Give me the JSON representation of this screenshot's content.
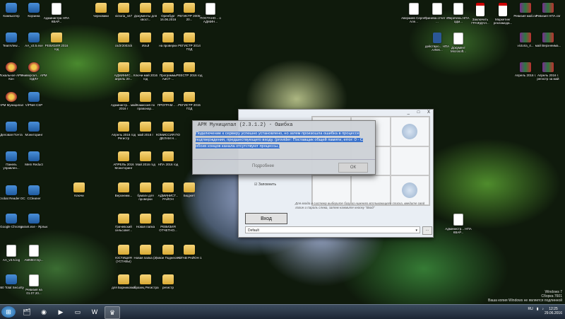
{
  "desktop": {
    "icons": [
      {
        "label": "Компьютер",
        "kind": "app"
      },
      {
        "label": "Корзина",
        "kind": "app"
      },
      {
        "label": "Администра НПА КВАР...",
        "kind": "doc"
      },
      {
        "label": "черновики",
        "kind": "folder"
      },
      {
        "label": "victoria_447",
        "kind": "folder"
      },
      {
        "label": "Документы для хвост...",
        "kind": "folder"
      },
      {
        "label": "Оренбург 16.06.2016",
        "kind": "folder"
      },
      {
        "label": "РЕГИСТР 2005-20...",
        "kind": "folder"
      },
      {
        "label": "ПОСТАНО... о АДМИН...",
        "kind": "doc"
      },
      {
        "label": "Аверкиев Сергей Але...",
        "kind": "doc"
      },
      {
        "label": "Гринева отчет по ...",
        "kind": "doc"
      },
      {
        "label": "Перечень НПА адм...",
        "kind": "doc"
      },
      {
        "label": "Заключить ГРАЖДАН...",
        "kind": "pdf"
      },
      {
        "label": "Маркетинг рекламода...",
        "kind": "pdf"
      },
      {
        "label": "Ревизия май.rar",
        "kind": "rar"
      },
      {
        "label": "Ревизия НПА.rar",
        "kind": "rar"
      },
      {
        "label": "TeamView...",
        "kind": "app"
      },
      {
        "label": "AA_v3.5.exe",
        "kind": "app"
      },
      {
        "label": "РЕВИЗИЯ 2016 год",
        "kind": "folder"
      },
      {
        "label": "сsdrr2003ck",
        "kind": "folder"
      },
      {
        "label": "Изъй",
        "kind": "folder"
      },
      {
        "label": "на проверки",
        "kind": "folder"
      },
      {
        "label": "РЕГИСТР 2014 ГОД",
        "kind": "folder"
      },
      {
        "label": "действую... НПА АЛЕК...",
        "kind": "word"
      },
      {
        "label": "Документ Microsoft...",
        "kind": "doc"
      },
      {
        "label": "victoria_4...",
        "kind": "rar"
      },
      {
        "label": "май Верхнеима...",
        "kind": "rar"
      },
      {
        "label": "Локальное АРМ Кон",
        "kind": "crest"
      },
      {
        "label": "Универсал... АРМ ОДЛУ",
        "kind": "crest"
      },
      {
        "label": "АДМИНИС... апрель 20...",
        "kind": "folder"
      },
      {
        "label": "Ключи май 2016 год",
        "kind": "folder"
      },
      {
        "label": "Программы АиСТ-...",
        "kind": "folder"
      },
      {
        "label": "РЕЕСТР 2016 год",
        "kind": "folder"
      },
      {
        "label": "Апрель 2016 г.",
        "kind": "rar"
      },
      {
        "label": "Апрель 2016 г. регистр за май 2016...",
        "kind": "rar"
      },
      {
        "label": "АРМ Муниципал",
        "kind": "crest"
      },
      {
        "label": "ViPNet CSP",
        "kind": "app"
      },
      {
        "label": "Администр... май 2016 г",
        "kind": "folder"
      },
      {
        "label": "Комиссия по правонар...",
        "kind": "folder"
      },
      {
        "label": "ПРОГРАМ... ...",
        "kind": "folder"
      },
      {
        "label": "РЕГИСТР 2015 ГОД",
        "kind": "folder"
      },
      {
        "label": "Деловая Почта",
        "kind": "app"
      },
      {
        "label": "Мониторинг",
        "kind": "app"
      },
      {
        "label": "Апрель 2016 год Регистр",
        "kind": "folder"
      },
      {
        "label": "май 2016 г",
        "kind": "folder"
      },
      {
        "label": "КОМИССИЯ ПО ДЕЛАМ Н...",
        "kind": "folder"
      },
      {
        "label": "Панель управлен...",
        "kind": "app"
      },
      {
        "label": "Mem Reduct",
        "kind": "app"
      },
      {
        "label": "АПРЕЛЬ 2016 Мониторинг",
        "kind": "folder"
      },
      {
        "label": "Май 2016 год",
        "kind": "folder"
      },
      {
        "label": "НПА 2016 год",
        "kind": "folder"
      },
      {
        "label": "Ключи",
        "kind": "folder"
      },
      {
        "label": "Верхнеим...",
        "kind": "folder"
      },
      {
        "label": "Acrobat Reader DC",
        "kind": "app"
      },
      {
        "label": "CCleaner",
        "kind": "app"
      },
      {
        "label": "бумаги для проверки",
        "kind": "folder"
      },
      {
        "label": "АДМИНИСТ... РАЙОН",
        "kind": "folder"
      },
      {
        "label": "Бюджет",
        "kind": "folder"
      },
      {
        "label": "Google Chrome",
        "kind": "app"
      },
      {
        "label": "garant.exe - Ярлык",
        "kind": "app"
      },
      {
        "label": "Грачевский сельсовет...",
        "kind": "folder"
      },
      {
        "label": "Новая папка",
        "kind": "folder"
      },
      {
        "label": "РЕВИЗИЯ ОТЧЕТНО...",
        "kind": "folder"
      },
      {
        "label": "Администр... НПА КВАР...",
        "kind": "doc"
      },
      {
        "label": "AA_v3.5.log",
        "kind": "doc"
      },
      {
        "label": "АММЕУ.mp...",
        "kind": "doc"
      },
      {
        "label": "ЮСТИЦИЯ (УСТАВЫ)",
        "kind": "folder"
      },
      {
        "label": "Новая папка (2)",
        "kind": "folder"
      },
      {
        "label": "Новое Поднесени",
        "kind": "folder"
      },
      {
        "label": "УСТАВ РАЙОН 1",
        "kind": "folder"
      },
      {
        "label": "360 Total Security",
        "kind": "app"
      },
      {
        "label": "Ревизия на 01.07.20...",
        "kind": "doc"
      },
      {
        "label": "для Барниковой",
        "kind": "folder"
      },
      {
        "label": "образец Регистра",
        "kind": "folder"
      },
      {
        "label": "регистр",
        "kind": "folder"
      }
    ],
    "colors": {
      "selection": "#3b73cc",
      "taskbar": "#1c2634"
    }
  },
  "app_window": {
    "controls": [
      "_",
      "□",
      "X"
    ],
    "remember_label": "Запомнить",
    "hint": "Для входа в систему выберите базу из нижнего всплывающего списка, введите свой логин и пароль слева, затем нажмите кнопку \"Вход\"",
    "login_button": "Вход",
    "database_value": "Default",
    "browse_button": "..."
  },
  "error_dialog": {
    "title": "АРМ Муниципал (2.3.1.2) - Ошибка",
    "message": "Подключение к серверу успешно установлено, но затем произошла ошибка в процессе подтверждения, предшествующего входу. (provider: Поставщик общей памяти, error: 0 - С обоих концов канала отсутствуют процессы.)",
    "details_label": "Подробнее",
    "ok_label": "ОК"
  },
  "watermark": {
    "line1": "Windows 7",
    "line2": "Сборка 7601",
    "line3": "Ваша копия Windows не является подлинной"
  },
  "taskbar": {
    "items": [
      {
        "icon": "windows-explorer-icon",
        "active": false
      },
      {
        "icon": "chrome-icon",
        "active": false
      },
      {
        "icon": "media-player-icon",
        "active": false
      },
      {
        "icon": "folder-icon",
        "active": false
      },
      {
        "icon": "word-icon",
        "active": false
      },
      {
        "icon": "arm-municipal-icon",
        "active": true
      }
    ],
    "language": "RU",
    "time": "12:25",
    "date": "29.06.2016"
  }
}
